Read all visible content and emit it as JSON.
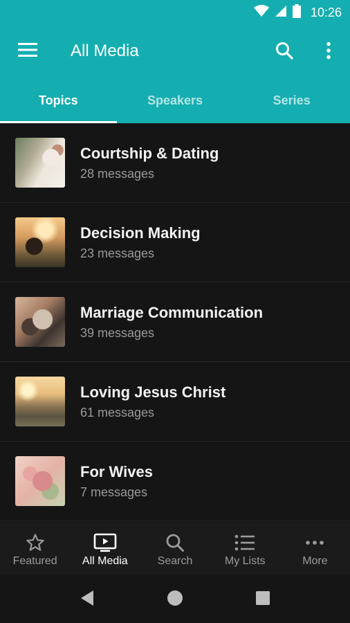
{
  "status_bar": {
    "time": "10:26",
    "icons": [
      "wifi-icon",
      "cell-signal-icon",
      "battery-icon"
    ]
  },
  "app_bar": {
    "title": "All Media",
    "menu_icon": "hamburger-menu-icon",
    "search_icon": "search-icon",
    "overflow_icon": "more-vert-icon"
  },
  "tabs": [
    {
      "label": "Topics",
      "active": true
    },
    {
      "label": "Speakers",
      "active": false
    },
    {
      "label": "Series",
      "active": false
    }
  ],
  "topics": [
    {
      "title": "Courtship & Dating",
      "count": "28 messages"
    },
    {
      "title": "Decision Making",
      "count": "23 messages"
    },
    {
      "title": "Marriage Communication",
      "count": "39 messages"
    },
    {
      "title": "Loving Jesus Christ",
      "count": "61 messages"
    },
    {
      "title": "For Wives",
      "count": "7 messages"
    }
  ],
  "bottom_nav": [
    {
      "label": "Featured",
      "icon": "star-icon",
      "active": false
    },
    {
      "label": "All Media",
      "icon": "tv-play-icon",
      "active": true
    },
    {
      "label": "Search",
      "icon": "search-icon",
      "active": false
    },
    {
      "label": "My Lists",
      "icon": "list-icon",
      "active": false
    },
    {
      "label": "More",
      "icon": "more-horiz-icon",
      "active": false
    }
  ],
  "colors": {
    "accent": "#15aeb0",
    "background": "#151515",
    "nav_background": "#1b1b1b"
  }
}
